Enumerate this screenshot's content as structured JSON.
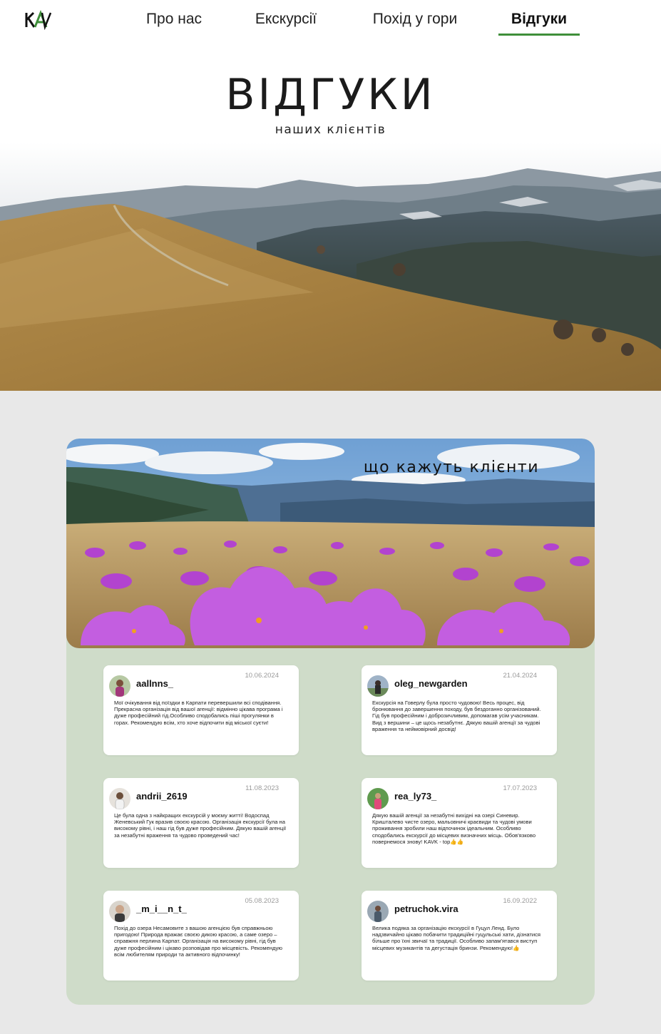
{
  "nav": {
    "items": [
      {
        "label": "Про нас"
      },
      {
        "label": "Екскурсії"
      },
      {
        "label": "Похід у гори"
      },
      {
        "label": "Відгуки"
      }
    ],
    "active_index": 3,
    "accent_color": "#3f8f3a"
  },
  "hero": {
    "title": "ВІДГУКИ",
    "subtitle": "наших клієнтів"
  },
  "reviews_section": {
    "title": "що кажуть клієнти",
    "background_color": "#cfdcc9"
  },
  "reviews": [
    {
      "username": "aallnns_",
      "date": "10.06.2024",
      "text": "Мої очікування від поїздки в Карпати перевершили всі сподівання. Прекрасна організація від вашої агенції: відмінно цікава програма і дуже професійний гід.Особливо сподобались піші прогулянки в горах. Рекомендую всім, хто хоче відпочити від міської суєти!"
    },
    {
      "username": "oleg_newgarden",
      "date": "21.04.2024",
      "text": "Екскурсія на Говерлу була просто чудовою! Весь процес, від бронювання до завершення походу, був бездоганно організований. Гід був професійним і доброзичливим, допомагав усім учасникам. Вид з вершини – це щось незабутнє. Дякую вашій агенції за чудові враження та неймовірний досвід!"
    },
    {
      "username": "andrii_2619",
      "date": "11.08.2023",
      "text": "Це була одна з найкращих екскурсій у моєму житті! Водоспад Женевський Гук вразив своєю красою. Організація екскурсії була на високому рівні, і наш гід був дуже професійним. Дякую вашій агенції за незабутні враження та чудово проведений час!"
    },
    {
      "username": "rea_ly73_",
      "date": "17.07.2023",
      "text": "Дякую вашій агенції за незабутні вихідні на озері Синевир. Кришталево чисте озеро, мальовничі краєвиди та чудові умови проживання зробили наш відпочинок ідеальним. Особливо сподобались екскурсії до місцевих визначних місць. Обов'язково повернемося знову! KAVK - top👍👍"
    },
    {
      "username": "_m_i__n_t_",
      "date": "05.08.2023",
      "text": "Похід до озера Несамовите з вашою агенцією був справжньою пригодою! Природа вражає своєю дикою красою, а саме озеро – справжня перлина Карпат. Організація на високому рівні, гід був дуже професійним і цікаво розповідав про місцевість. Рекомендую всім любителям природи та активного відпочинку!"
    },
    {
      "username": "petruchok.vira",
      "date": "16.09.2022",
      "text": "Велика подяка за організацію екскурсії в Гуцул Ленд. Було надзвичайно цікаво побачити традиційні гуцульські хати, дізнатися більше про їхні звичаї та традиції. Особливо запам'ятався виступ місцевих музикантів та дегустація бринзи. Рекомендую!👍"
    }
  ]
}
